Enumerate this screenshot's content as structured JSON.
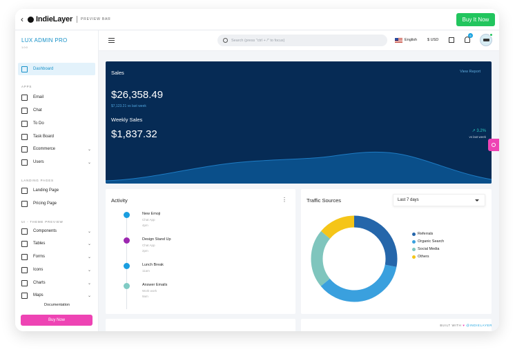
{
  "topbar": {
    "back_icon": "chevron-left-icon",
    "brand": "IndieLayer",
    "preview_label": "PREVIEW BAR",
    "buy_label": "Buy It Now"
  },
  "sidebar": {
    "app_title": "LUX ADMIN PRO",
    "version": "1.0.0",
    "items": [
      {
        "label": "Dashboard",
        "icon": "dashboard-icon",
        "active": true
      },
      {
        "section": "APPS"
      },
      {
        "label": "Email",
        "icon": "mail-icon"
      },
      {
        "label": "Chat",
        "icon": "chat-icon"
      },
      {
        "label": "To Do",
        "icon": "list-icon"
      },
      {
        "label": "Task Board",
        "icon": "board-icon"
      },
      {
        "label": "Ecommerce",
        "icon": "store-icon",
        "chevron": true
      },
      {
        "label": "Users",
        "icon": "users-icon",
        "chevron": true
      },
      {
        "section": "LANDING PAGES"
      },
      {
        "label": "Landing Page",
        "icon": "plane-icon"
      },
      {
        "label": "Pricing Page",
        "icon": "dollar-icon"
      },
      {
        "section": "UI - THEME PREVIEW"
      },
      {
        "label": "Components",
        "icon": "cube-icon",
        "chevron": true
      },
      {
        "label": "Tables",
        "icon": "table-icon",
        "chevron": true
      },
      {
        "label": "Forms",
        "icon": "form-icon",
        "chevron": true
      },
      {
        "label": "Icons",
        "icon": "shapes-icon",
        "chevron": true
      },
      {
        "label": "Charts",
        "icon": "chart-icon",
        "chevron": true
      },
      {
        "label": "Maps",
        "icon": "map-icon",
        "chevron": true
      }
    ],
    "documentation": "Documentation",
    "buy_now": "Buy Now"
  },
  "header": {
    "search_placeholder": "Search (press \"ctrl + /\" to focus)",
    "language": "English",
    "currency": "$ USD",
    "notification_count": "6"
  },
  "sales": {
    "title": "Sales",
    "view_report": "View Report",
    "total": "$26,358.49",
    "vs_last_week": "$7,123.21 vs last week",
    "weekly_title": "Weekly Sales",
    "weekly_total": "$1,837.32",
    "growth": "↗ 3.2%",
    "growth_label": "vs last week",
    "colors": {
      "background": "#062b55",
      "wave": "#0d5c99"
    }
  },
  "activity": {
    "title": "Activity",
    "items": [
      {
        "title": "New Emoji",
        "source": "Chat App",
        "time": "4pm",
        "color": "#1a9ee0"
      },
      {
        "title": "Design Stand Up",
        "source": "Chat App",
        "time": "2pm",
        "color": "#9c27b0"
      },
      {
        "title": "Lunch Break",
        "source": "",
        "time": "11am",
        "color": "#1a9ee0"
      },
      {
        "title": "Answer Emails",
        "source": "Work work",
        "time": "9am",
        "color": "#80cbc4"
      }
    ]
  },
  "traffic": {
    "title": "Traffic Sources",
    "range": "Last 7 days",
    "chart_data": {
      "type": "pie",
      "labels": [
        "Referrals",
        "Organic Search",
        "Social Media",
        "Others"
      ],
      "values": [
        28,
        36,
        22,
        14
      ],
      "colors": [
        "#2566aa",
        "#3aa0de",
        "#7fc5bd",
        "#f5c518"
      ]
    }
  },
  "footer": {
    "built_with": "BUILT WITH",
    "heart": "♥",
    "by": "@INDIELAYER"
  }
}
